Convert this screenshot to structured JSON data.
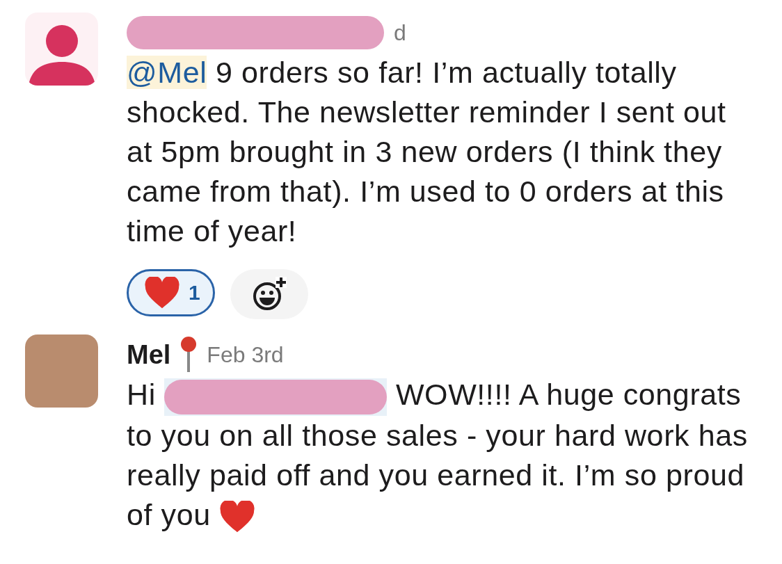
{
  "messages": [
    {
      "author_redacted": true,
      "timestamp": "d",
      "avatar_photo": false,
      "mention": "@Mel",
      "text": "9 orders so far! I’m actually totally shocked. The newsletter reminder I sent out at 5pm brought in 3 new orders (I think they came from that). I’m used to 0 orders at this time of year!",
      "reactions": [
        {
          "count": "1",
          "selected": true
        }
      ],
      "add_reaction": true
    },
    {
      "author": "Mel",
      "pinned": true,
      "timestamp": "Feb 3rd",
      "avatar_photo": true,
      "greeting": "Hi",
      "mention_redacted": true,
      "text": "WOW!!!! A huge congrats to you on all those sales - your hard work has really paid off and you earned it. I’m so proud of you",
      "ends_with_heart": true
    }
  ]
}
